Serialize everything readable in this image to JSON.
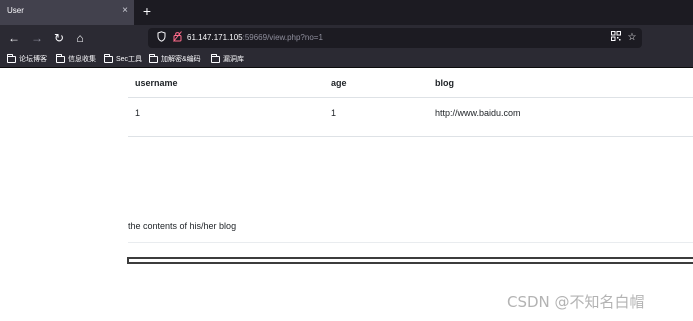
{
  "browser": {
    "tab_title": "User",
    "tab_close_glyph": "×",
    "new_tab_glyph": "+",
    "nav": {
      "back": "←",
      "forward": "→",
      "reload": "↻",
      "home": "⌂"
    },
    "url_host": "61.147.171.105",
    "url_rest": ":59669/view.php?no=1",
    "url_icons": {
      "shield": "shield-icon",
      "lock": "lock-insecure-icon",
      "qr": "qr-code-icon",
      "star": "bookmark-star-icon"
    },
    "bookmarks": [
      "论坛博客",
      "信息收集",
      "Sec工具",
      "加解密&编码",
      "漏洞库"
    ]
  },
  "page": {
    "table": {
      "headers": [
        "username",
        "age",
        "blog"
      ],
      "rows": [
        [
          "1",
          "1",
          "http://www.baidu.com"
        ]
      ]
    },
    "blog_caption": "the contents of his/her blog"
  },
  "watermark": "CSDN @不知名白帽",
  "colors": {
    "tabbar": "#1c1b22",
    "toolbar": "#2b2a33",
    "insecure_lock": "#ff6b8b"
  }
}
